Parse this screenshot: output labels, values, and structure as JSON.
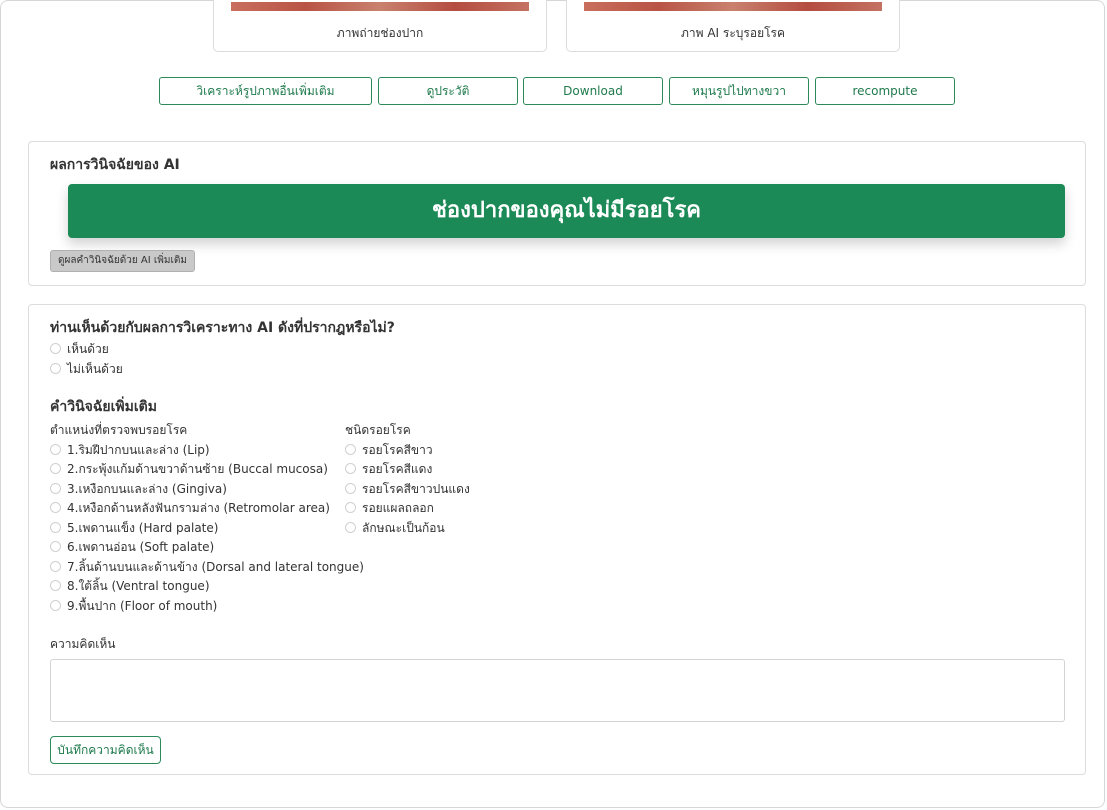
{
  "images": {
    "photo_caption": "ภาพถ่ายช่องปาก",
    "ai_caption": "ภาพ AI ระบุรอยโรค"
  },
  "actions": [
    "วิเคราะห์รูปภาพอื่นเพิ่มเติม",
    "ดูประวัติ",
    "Download",
    "หมุนรูปไปทางขวา",
    "recompute"
  ],
  "ai_result": {
    "title": "ผลการวินิจฉัยของ AI",
    "banner": "ช่องปากของคุณไม่มีรอยโรค",
    "more_button": "ดูผลคำวินิจฉัยด้วย AI เพิ่มเติม",
    "banner_color": "#1b8a56"
  },
  "feedback": {
    "question": "ท่านเห็นด้วยกับผลการวิเคราะทาง AI ดังที่ปรากฎหรือไม่?",
    "options": [
      "เห็นด้วย",
      "ไม่เห็นด้วย"
    ],
    "extra_title": "คำวินิจฉัยเพิ่มเติม",
    "location_header": "ตำแหน่งที่ตรวจพบรอยโรค",
    "locations": [
      "1.ริมฝีปากบนและล่าง (Lip)",
      "2.กระพุ้งแก้มด้านขวาด้านซ้าย (Buccal mucosa)",
      "3.เหงือกบนและล่าง (Gingiva)",
      "4.เหงือกด้านหลังฟันกรามล่าง (Retromolar area)",
      "5.เพดานแข็ง (Hard palate)",
      "6.เพดานอ่อน (Soft palate)",
      "7.ลิ้นด้านบนและด้านข้าง (Dorsal and lateral tongue)",
      "8.ใต้ลิ้น (Ventral tongue)",
      "9.พื้นปาก (Floor of mouth)"
    ],
    "type_header": "ชนิดรอยโรค",
    "types": [
      "รอยโรคสีขาว",
      "รอยโรคสีแดง",
      "รอยโรคสีขาวปนแดง",
      "รอยแผลถลอก",
      "ลักษณะเป็นก้อน"
    ],
    "comment_label": "ความคิดเห็น",
    "comment_value": "",
    "save_button": "บันทึกความคิดเห็น"
  },
  "colors": {
    "accent": "#1f7a4c",
    "border": "#2c8a5a"
  }
}
